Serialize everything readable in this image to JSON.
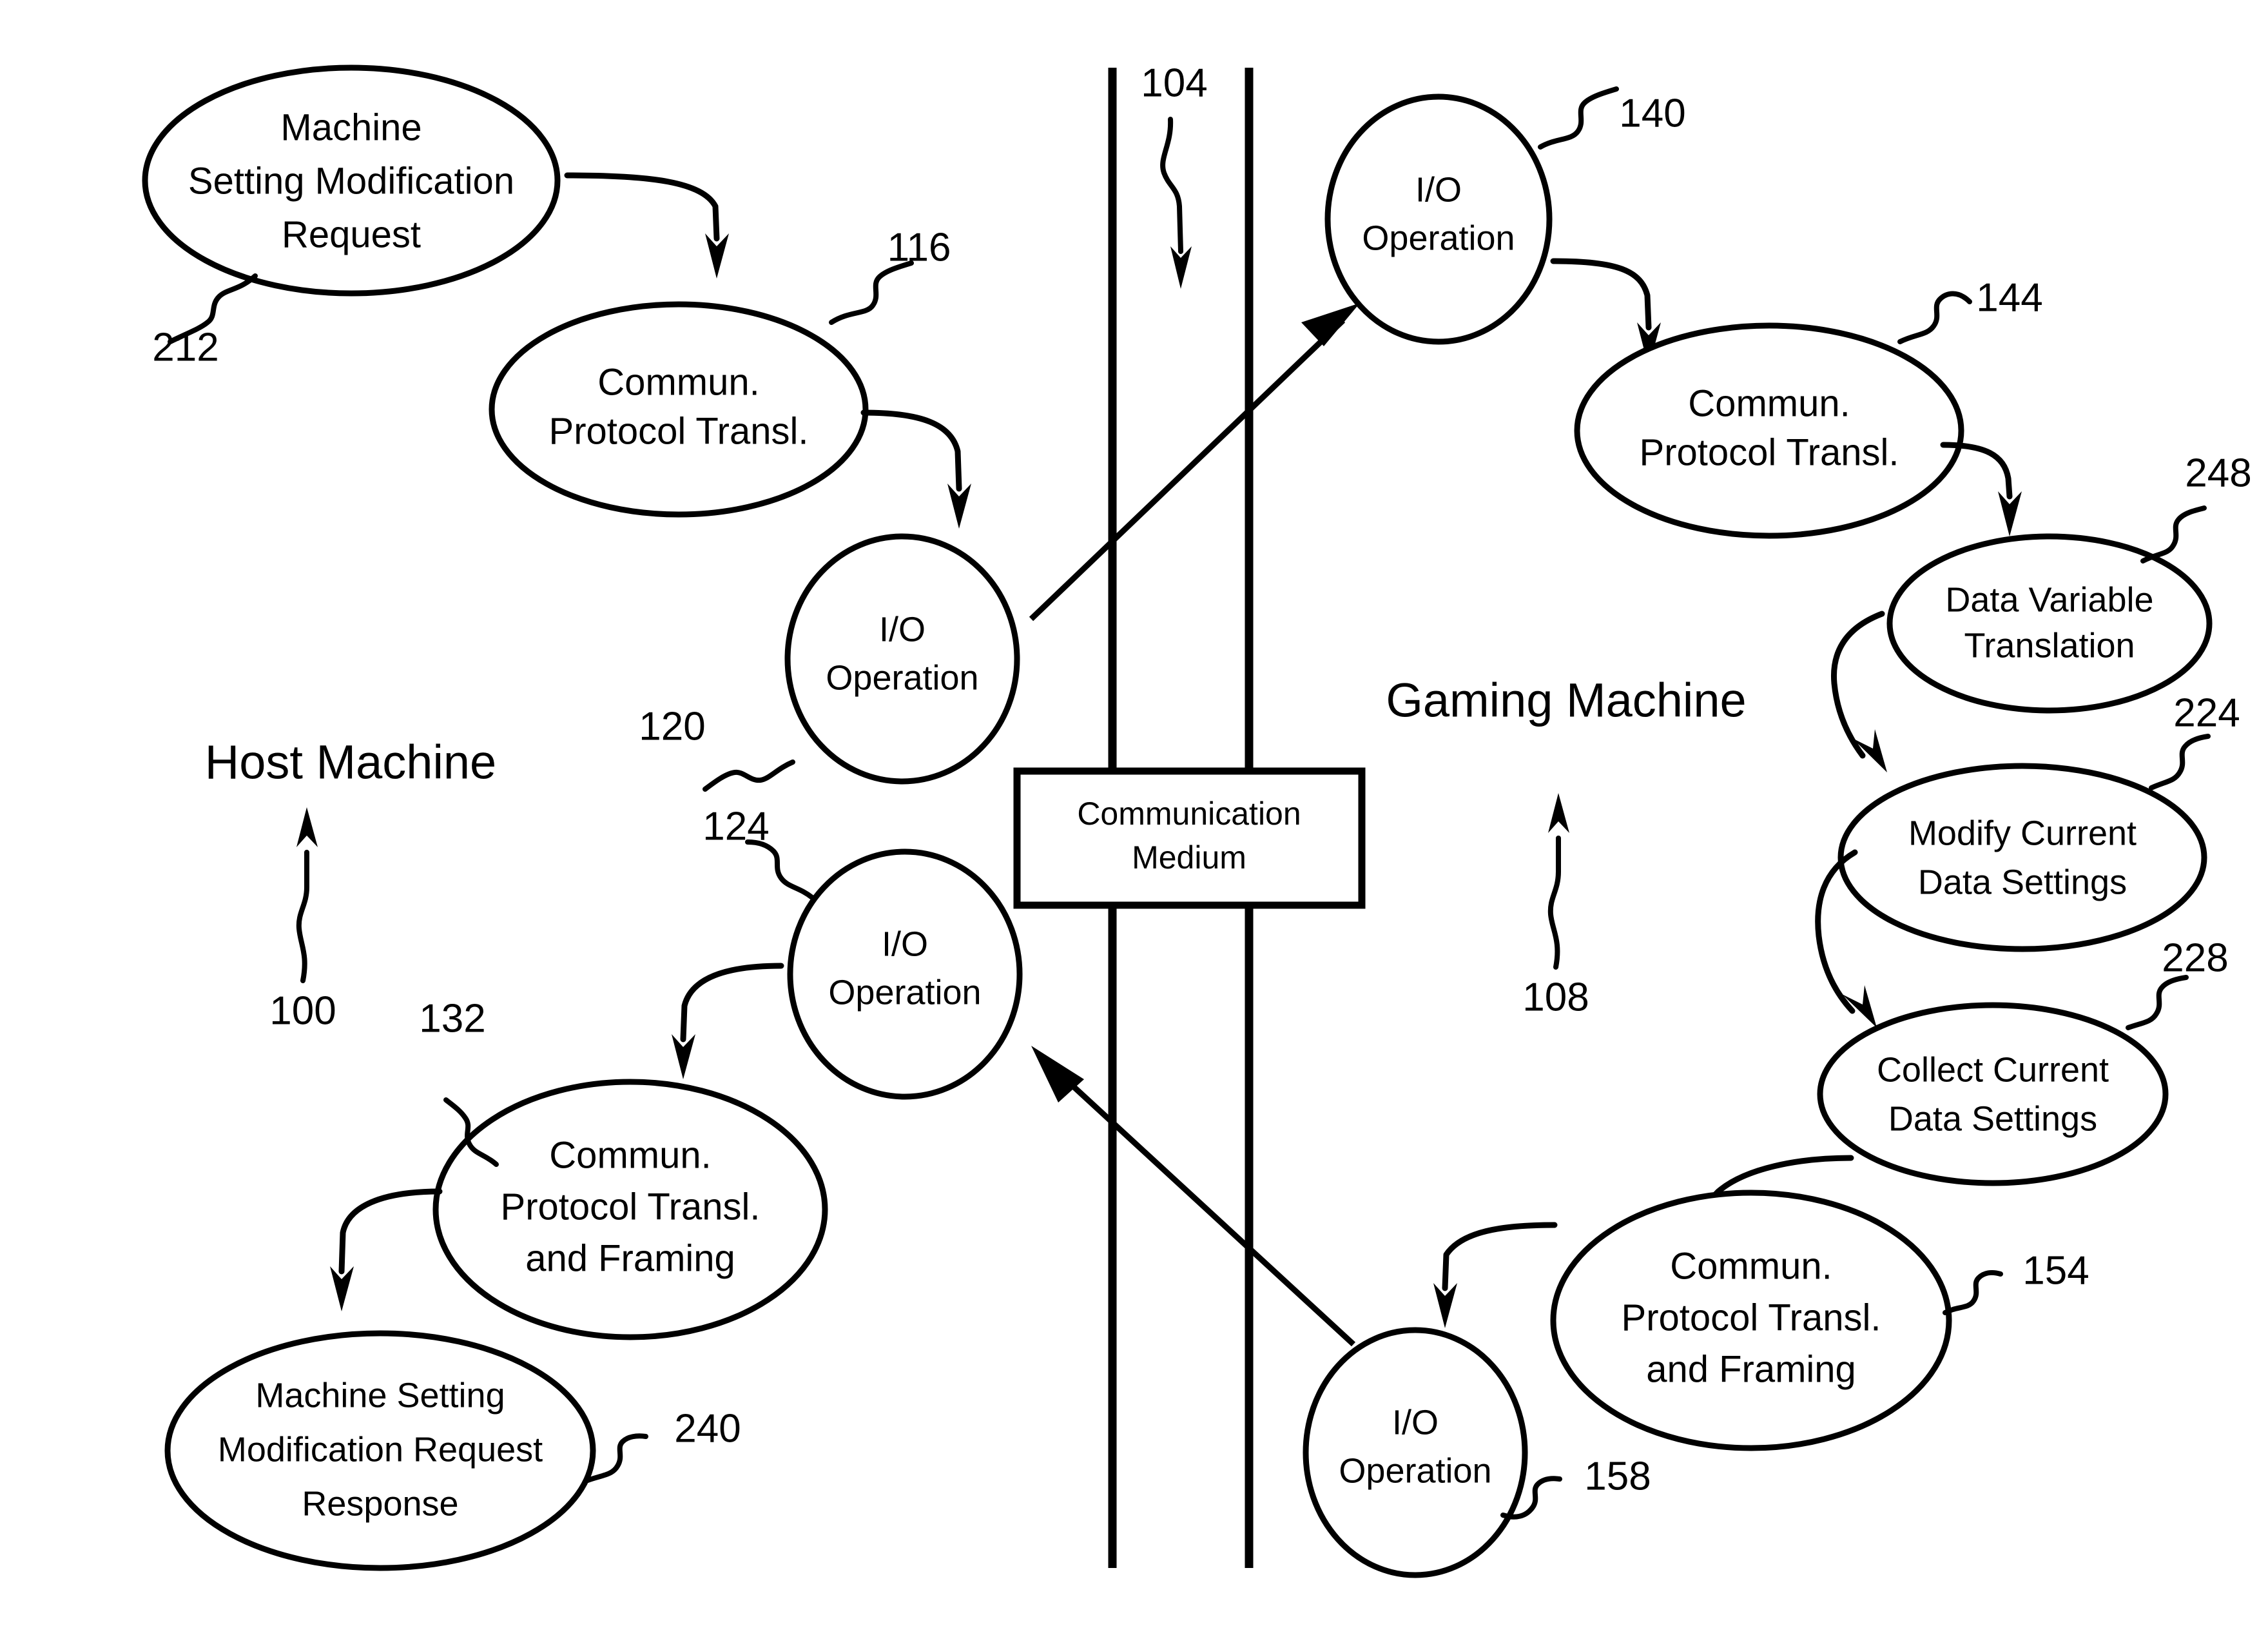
{
  "figure": {
    "kind": "patent-flow-diagram",
    "background_color": "#ffffff",
    "line_color": "#000000"
  },
  "sections": {
    "host": {
      "label": "Host Machine",
      "ref": "100"
    },
    "gaming": {
      "label": "Gaming Machine",
      "ref": "108"
    },
    "medium": {
      "label_line1": "Communication",
      "label_line2": "Medium",
      "ref": "104"
    }
  },
  "nodes": {
    "machine_setting_modification_request": {
      "ref": "212",
      "lines": [
        "Machine",
        "Setting Modification",
        "Request"
      ]
    },
    "host_protocol_transl_out": {
      "ref": "116",
      "lines": [
        "Commun.",
        "Protocol Transl."
      ]
    },
    "host_io_out": {
      "ref": "120",
      "lines": [
        "I/O",
        "Operation"
      ]
    },
    "gaming_io_in": {
      "ref": "140",
      "lines": [
        "I/O",
        "Operation"
      ]
    },
    "gaming_protocol_transl_in": {
      "ref": "144",
      "lines": [
        "Commun.",
        "Protocol Transl."
      ]
    },
    "data_variable_translation": {
      "ref": "248",
      "lines": [
        "Data Variable",
        "Translation"
      ]
    },
    "modify_current_data_settings": {
      "ref": "224",
      "lines": [
        "Modify Current",
        "Data  Settings"
      ]
    },
    "collect_current_data_settings": {
      "ref": "228",
      "lines": [
        "Collect Current",
        "Data  Settings"
      ]
    },
    "gaming_protocol_transl_out": {
      "ref": "154",
      "lines": [
        "Commun.",
        "Protocol Transl.",
        "and Framing"
      ]
    },
    "gaming_io_out": {
      "ref": "158",
      "lines": [
        "I/O",
        "Operation"
      ]
    },
    "host_io_in": {
      "ref": "124",
      "lines": [
        "I/O",
        "Operation"
      ]
    },
    "host_protocol_transl_in": {
      "ref": "132",
      "lines": [
        "Commun.",
        "Protocol Transl.",
        "and Framing"
      ]
    },
    "machine_setting_modification_request_response": {
      "ref": "240",
      "lines": [
        "Machine Setting",
        "Modification Request",
        "Response"
      ]
    }
  },
  "reference_numerals": [
    "100",
    "104",
    "108",
    "116",
    "120",
    "124",
    "132",
    "140",
    "144",
    "154",
    "158",
    "212",
    "224",
    "228",
    "240",
    "248"
  ]
}
